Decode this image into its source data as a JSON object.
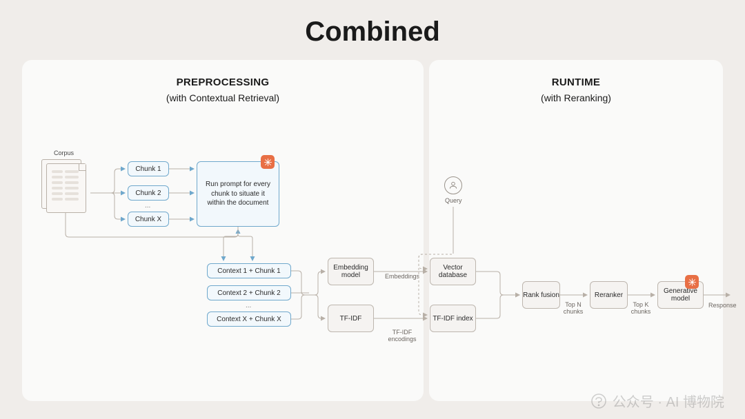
{
  "title": "Combined",
  "preprocessing": {
    "heading": "PREPROCESSING",
    "subtitle": "(with Contextual Retrieval)",
    "corpus_label": "Corpus",
    "chunks": [
      "Chunk 1",
      "Chunk 2",
      "Chunk X"
    ],
    "chunk_ellipsis": "...",
    "prompt_box": "Run prompt for every chunk to situate it within the document",
    "contexts": [
      "Context 1 + Chunk 1",
      "Context 2 + Chunk 2",
      "Context X + Chunk X"
    ],
    "context_ellipsis": "..."
  },
  "blocks": {
    "embedding": "Embedding model",
    "tfidf": "TF-IDF",
    "vector_db": "Vector database",
    "tfidf_index": "TF-IDF index",
    "rank_fusion": "Rank fusion",
    "reranker": "Reranker",
    "generative": "Generative model"
  },
  "runtime": {
    "heading": "RUNTIME",
    "subtitle": "(with Reranking)",
    "query_label": "Query"
  },
  "edge_labels": {
    "embeddings": "Embeddings",
    "tfidf_encodings": "TF-IDF encodings",
    "top_n": "Top N chunks",
    "top_k": "Top K chunks",
    "response": "Response"
  },
  "watermark": "公众号 · AI 博物院"
}
